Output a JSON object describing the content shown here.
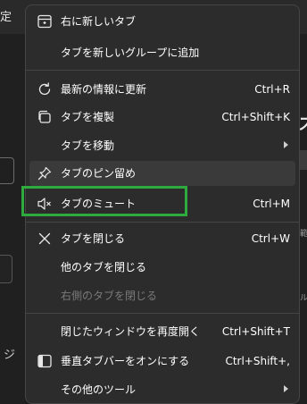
{
  "background": {
    "settings_fragment": "定",
    "right_heading_fragment": "ス",
    "right_text_fragment_1": "範",
    "right_text_fragment_2": "ル",
    "left_glyph_fragment": "ジ"
  },
  "menu": {
    "items": [
      {
        "label": "右に新しいタブ",
        "shortcut": "",
        "icon": "new-tab-icon"
      },
      {
        "label": "タブを新しいグループに追加",
        "shortcut": "",
        "icon": ""
      },
      {
        "label": "最新の情報に更新",
        "shortcut": "Ctrl+R",
        "icon": "refresh-icon"
      },
      {
        "label": "タブを複製",
        "shortcut": "Ctrl+Shift+K",
        "icon": "duplicate-icon"
      },
      {
        "label": "タブを移動",
        "shortcut": "",
        "icon": "",
        "submenu": true
      },
      {
        "label": "タブのピン留め",
        "shortcut": "",
        "icon": "pin-icon"
      },
      {
        "label": "タブのミュート",
        "shortcut": "Ctrl+M",
        "icon": "speaker-mute-icon"
      },
      {
        "label": "タブを閉じる",
        "shortcut": "Ctrl+W",
        "icon": "close-icon"
      },
      {
        "label": "他のタブを閉じる",
        "shortcut": "",
        "icon": ""
      },
      {
        "label": "右側のタブを閉じる",
        "shortcut": "",
        "icon": "",
        "disabled": true
      },
      {
        "label": "閉じたウィンドウを再度開く",
        "shortcut": "Ctrl+Shift+T",
        "icon": ""
      },
      {
        "label": "垂直タブバーをオンにする",
        "shortcut": "Ctrl+Shift+,",
        "icon": "vertical-tabs-icon"
      },
      {
        "label": "その他のツール",
        "shortcut": "",
        "icon": "",
        "submenu": true
      }
    ]
  },
  "colors": {
    "menu_background": "#2c2c2c",
    "hover_background": "#3a3a3a",
    "highlight_border": "#2eaa3e",
    "disabled_text": "#7a7a7a"
  }
}
